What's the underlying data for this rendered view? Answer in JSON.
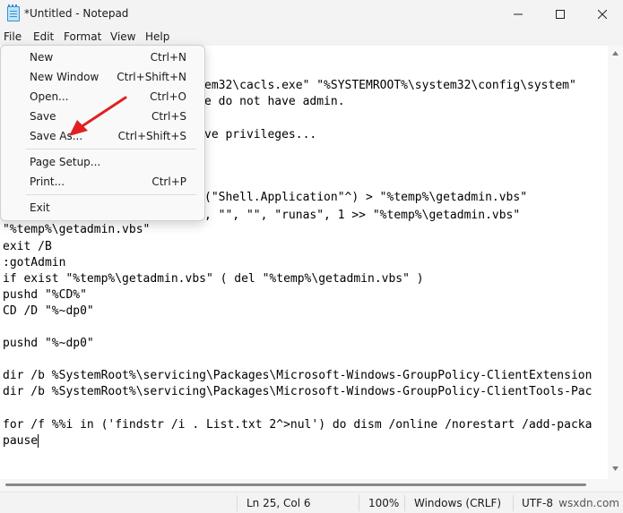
{
  "window": {
    "title": "*Untitled - Notepad",
    "minimize_icon": "minimize-icon",
    "maximize_icon": "maximize-icon",
    "close_icon": "close-icon"
  },
  "menubar": {
    "items": [
      "File",
      "Edit",
      "Format",
      "View",
      "Help"
    ]
  },
  "file_menu": {
    "items": [
      {
        "label": "New",
        "shortcut": "Ctrl+N"
      },
      {
        "label": "New Window",
        "shortcut": "Ctrl+Shift+N"
      },
      {
        "label": "Open...",
        "shortcut": "Ctrl+O"
      },
      {
        "label": "Save",
        "shortcut": "Ctrl+S"
      },
      {
        "label": "Save As...",
        "shortcut": "Ctrl+Shift+S"
      },
      {
        "label": "Page Setup...",
        "shortcut": ""
      },
      {
        "label": "Print...",
        "shortcut": "Ctrl+P"
      },
      {
        "label": "Exit",
        "shortcut": ""
      }
    ]
  },
  "editor": {
    "lines": [
      "em32\\cacls.exe\" \"%SYSTEMROOT%\\system32\\config\\system\"",
      "e do not have admin.",
      "ve privileges...",
      "(\"Shell.Application\"^) > \"%temp%\\getadmin.vbs\"",
      ", \"\", \"\", \"runas\", 1 >> \"%temp%\\getadmin.vbs\"",
      "\"%temp%\\getadmin.vbs\"",
      "exit /B",
      ":gotAdmin",
      "if exist \"%temp%\\getadmin.vbs\" ( del \"%temp%\\getadmin.vbs\" )",
      "pushd \"%CD%\"",
      "CD /D \"%~dp0\"",
      "pushd \"%~dp0\"",
      "dir /b %SystemRoot%\\servicing\\Packages\\Microsoft-Windows-GroupPolicy-ClientExtension",
      "dir /b %SystemRoot%\\servicing\\Packages\\Microsoft-Windows-GroupPolicy-ClientTools-Pac",
      "for /f %%i in ('findstr /i . List.txt 2^>nul') do dism /online /norestart /add-packa",
      "pause"
    ]
  },
  "statusbar": {
    "position": "Ln 25, Col 6",
    "zoom": "100%",
    "line_ending": "Windows (CRLF)",
    "encoding": "UTF-8",
    "watermark": "wsxdn.com"
  },
  "colors": {
    "arrow": "#e02020",
    "chrome": "#f3f3f3"
  }
}
